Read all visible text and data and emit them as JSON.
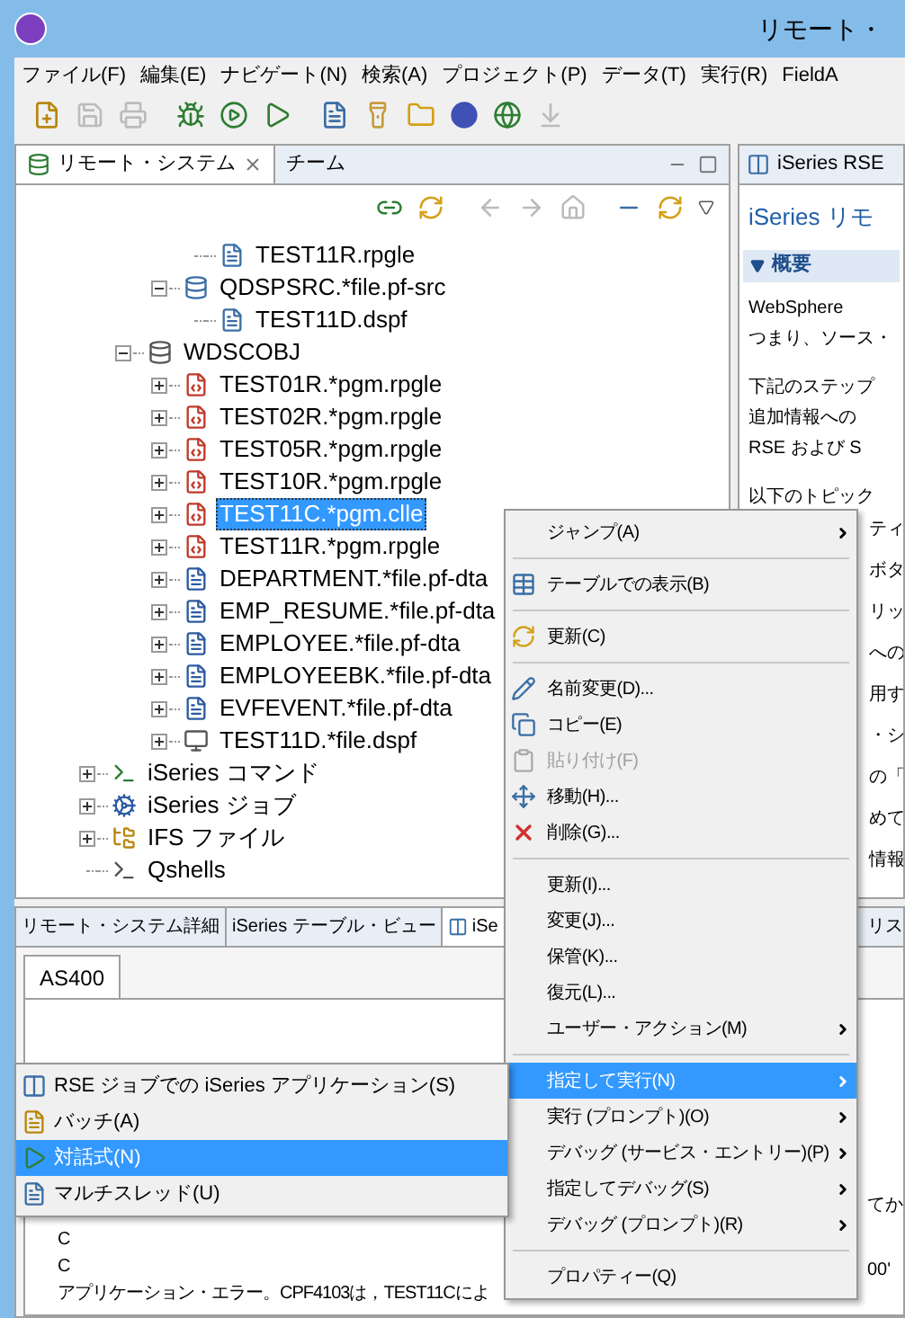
{
  "window": {
    "title": "リモート・"
  },
  "menu_bar": [
    "ファイル(F)",
    "編集(E)",
    "ナビゲート(N)",
    "検索(A)",
    "プロジェクト(P)",
    "データ(T)",
    "実行(R)",
    "FieldA"
  ],
  "left_view": {
    "tabs": [
      {
        "label": "リモート・システム",
        "selected": true,
        "closable": true
      },
      {
        "label": "チーム",
        "selected": false,
        "closable": false
      }
    ],
    "tree": [
      {
        "children": [
          {
            "children": [
              {
                "children": [
                  {
                    "label": "TEST11R.rpgle",
                    "kind": "member",
                    "selected": false
                  }
                ]
              },
              {
                "label": "QDSPSRC.*file.pf-src",
                "kind": "source-file",
                "expanded": true,
                "selected": false,
                "children": [
                  {
                    "label": "TEST11D.dspf",
                    "kind": "member",
                    "selected": false
                  }
                ]
              }
            ]
          },
          {
            "label": "WDSCOBJ",
            "kind": "library",
            "expanded": true,
            "selected": false,
            "children": [
              {
                "label": "TEST01R.*pgm.rpgle",
                "kind": "program",
                "expanded": false,
                "selected": false
              },
              {
                "label": "TEST02R.*pgm.rpgle",
                "kind": "program",
                "expanded": false,
                "selected": false
              },
              {
                "label": "TEST05R.*pgm.rpgle",
                "kind": "program",
                "expanded": false,
                "selected": false
              },
              {
                "label": "TEST10R.*pgm.rpgle",
                "kind": "program",
                "expanded": false,
                "selected": false
              },
              {
                "label": "TEST11C.*pgm.clle",
                "kind": "program",
                "expanded": false,
                "selected": true
              },
              {
                "label": "TEST11R.*pgm.rpgle",
                "kind": "program",
                "expanded": false,
                "selected": false
              },
              {
                "label": "DEPARTMENT.*file.pf-dta",
                "kind": "data-file",
                "expanded": false,
                "selected": false
              },
              {
                "label": "EMP_RESUME.*file.pf-dta",
                "kind": "data-file",
                "expanded": false,
                "selected": false
              },
              {
                "label": "EMPLOYEE.*file.pf-dta",
                "kind": "data-file",
                "expanded": false,
                "selected": false
              },
              {
                "label": "EMPLOYEEBK.*file.pf-dta",
                "kind": "data-file",
                "expanded": false,
                "selected": false
              },
              {
                "label": "EVFEVENT.*file.pf-dta",
                "kind": "data-file",
                "expanded": false,
                "selected": false
              },
              {
                "label": "TEST11D.*file.dspf",
                "kind": "display-file",
                "expanded": false,
                "selected": false
              }
            ]
          }
        ]
      },
      {
        "label": "iSeries コマンド",
        "kind": "commands",
        "expanded": false,
        "selected": false
      },
      {
        "label": "iSeries ジョブ",
        "kind": "jobs",
        "expanded": false,
        "selected": false
      },
      {
        "label": "IFS ファイル",
        "kind": "ifs",
        "expanded": false,
        "selected": false
      },
      {
        "label": "Qshells",
        "kind": "shells",
        "selected": false
      }
    ]
  },
  "right_view": {
    "tab": "iSeries RSE",
    "title": "iSeries リモ",
    "section": "概要",
    "paragraphs": [
      [
        "WebSphere",
        "つまり、ソース・"
      ],
      [
        "下記のステップ",
        "追加情報への",
        "RSE および S"
      ],
      [
        "以下のトピック"
      ]
    ],
    "fragments": [
      "ティ",
      "ボタ",
      "リッ",
      "への",
      "用す",
      "・シ",
      "の「",
      "めて",
      "情報"
    ]
  },
  "bottom_view": {
    "tabs": [
      {
        "label": "リモート・システム詳細",
        "selected": false
      },
      {
        "label": "iSeries テーブル・ビュー",
        "selected": false
      },
      {
        "label": "iSe",
        "selected": true
      }
    ],
    "right_tab": "リス",
    "subtab": "AS400",
    "lines": [
      "C",
      "C",
      "アプリケーション・エラー。CPF4103は，TEST11Cによ"
    ],
    "fragments": [
      "てか",
      "00'"
    ]
  },
  "context_menu": [
    [
      {
        "label": "ジャンプ(A)",
        "submenu": true,
        "selected": false,
        "disabled": false
      }
    ],
    [
      {
        "label": "テーブルでの表示(B)",
        "kind": "table",
        "submenu": false,
        "selected": false,
        "disabled": false
      }
    ],
    [
      {
        "label": "更新(C)",
        "kind": "refresh",
        "submenu": false,
        "selected": false,
        "disabled": false
      }
    ],
    [
      {
        "label": "名前変更(D)...",
        "kind": "rename",
        "submenu": false,
        "selected": false,
        "disabled": false
      },
      {
        "label": "コピー(E)",
        "kind": "copy",
        "submenu": false,
        "selected": false,
        "disabled": false
      },
      {
        "label": "貼り付け(F)",
        "kind": "paste",
        "submenu": false,
        "selected": false,
        "disabled": true
      },
      {
        "label": "移動(H)...",
        "kind": "move",
        "submenu": false,
        "selected": false,
        "disabled": false
      },
      {
        "label": "削除(G)...",
        "kind": "delete",
        "submenu": false,
        "selected": false,
        "disabled": false
      }
    ],
    [
      {
        "label": "更新(I)...",
        "submenu": false,
        "selected": false,
        "disabled": false
      },
      {
        "label": "変更(J)...",
        "submenu": false,
        "selected": false,
        "disabled": false
      },
      {
        "label": "保管(K)...",
        "submenu": false,
        "selected": false,
        "disabled": false
      },
      {
        "label": "復元(L)...",
        "submenu": false,
        "selected": false,
        "disabled": false
      },
      {
        "label": "ユーザー・アクション(M)",
        "submenu": true,
        "selected": false,
        "disabled": false
      }
    ],
    [
      {
        "label": "指定して実行(N)",
        "submenu": true,
        "selected": true,
        "disabled": false
      },
      {
        "label": "実行 (プロンプト)(O)",
        "submenu": true,
        "selected": false,
        "disabled": false
      },
      {
        "label": "デバッグ (サービス・エントリー)(P)",
        "submenu": true,
        "selected": false,
        "disabled": false
      },
      {
        "label": "指定してデバッグ(S)",
        "submenu": true,
        "selected": false,
        "disabled": false
      },
      {
        "label": "デバッグ (プロンプト)(R)",
        "submenu": true,
        "selected": false,
        "disabled": false
      }
    ],
    [
      {
        "label": "プロパティー(Q)",
        "submenu": false,
        "selected": false,
        "disabled": false
      }
    ]
  ],
  "submenu": [
    {
      "label": "RSE ジョブでの iSeries アプリケーション(S)",
      "kind": "app",
      "selected": false
    },
    {
      "label": "バッチ(A)",
      "kind": "batch",
      "selected": false
    },
    {
      "label": "対話式(N)",
      "kind": "interactive",
      "selected": true
    },
    {
      "label": "マルチスレッド(U)",
      "kind": "multithread",
      "selected": false
    }
  ]
}
